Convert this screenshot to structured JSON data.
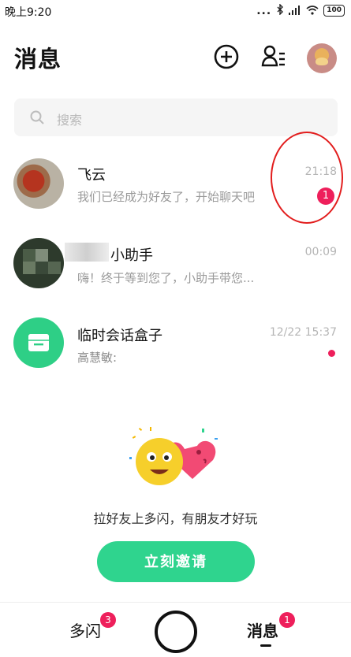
{
  "status_bar": {
    "time": "晚上9:20",
    "signal_dots": "...",
    "battery": "100",
    "icons": [
      "bluetooth-icon",
      "signal-icon",
      "wifi-icon",
      "battery-icon"
    ]
  },
  "header": {
    "title": "消息",
    "add_icon": "plus-circle-icon",
    "contacts_icon": "contacts-list-icon"
  },
  "search": {
    "placeholder": "搜索"
  },
  "conversations": [
    {
      "name": "飞云",
      "preview": "我们已经成为好友了，开始聊天吧",
      "time": "21:18",
      "unread": "1"
    },
    {
      "name": "小助手",
      "preview": "嗨！终于等到您了，小助手带您...",
      "time": "00:09"
    },
    {
      "name": "临时会话盒子",
      "preview": "高慧敏:",
      "time": "12/22 15:37"
    }
  ],
  "empty_state": {
    "text": "拉好友上多闪，有朋友才好玩",
    "button": "立刻邀请"
  },
  "bottom_nav": {
    "left_tab": "多闪",
    "left_badge": "3",
    "right_tab": "消息",
    "right_badge": "1"
  },
  "colors": {
    "accent": "#2fd48e",
    "badge": "#ee1f5b",
    "annotation": "#e21d1d"
  }
}
